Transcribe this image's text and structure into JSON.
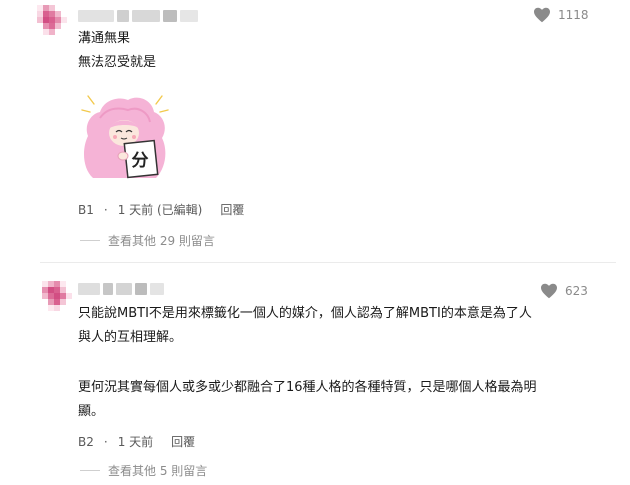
{
  "comments": [
    {
      "content_lines": [
        "溝通無果",
        "無法忍受就是"
      ],
      "likes": "1118",
      "floor": "B1",
      "time": "1 天前 (已編輯)",
      "reply_label": "回覆",
      "more_replies": "查看其他 29 則留言"
    },
    {
      "content_lines": [
        "只能說MBTI不是用來標籤化一個人的媒介，個人認為了解MBTI的本意是為了人",
        "與人的互相理解。",
        "",
        "更何況其實每個人或多或少都融合了16種人格的各種特質，只是哪個人格最為明",
        "顯。"
      ],
      "likes": "623",
      "floor": "B2",
      "time": "1 天前",
      "reply_label": "回覆",
      "more_replies": "查看其他 5 則留言"
    }
  ],
  "sticker": {
    "text": "分"
  },
  "colors": {
    "avatar_pink": "#d9608f",
    "like_gray": "#8a8a8a",
    "sticker_pink": "#f5b3d6"
  }
}
